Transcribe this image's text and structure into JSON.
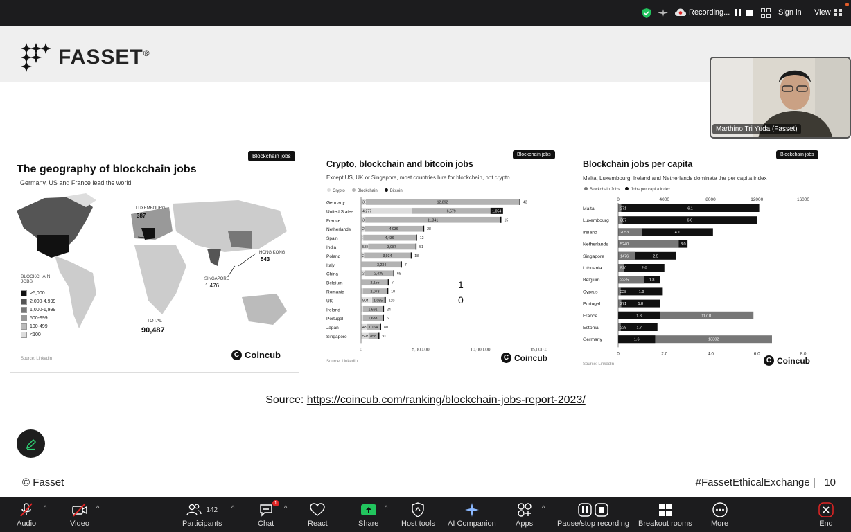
{
  "topbar": {
    "recording_label": "Recording...",
    "signin_label": "Sign in",
    "view_label": "View"
  },
  "slide": {
    "logo": "FASSET",
    "logo_mark": "®",
    "map": {
      "tag": "Blockchain jobs",
      "title": "The geography of blockchain jobs",
      "subtitle": "Germany, US and France lead the world",
      "legend_title": "BLOCKCHAIN JOBS",
      "legend": [
        {
          "label": ">5,000",
          "color": "#111111"
        },
        {
          "label": "2,000-4,999",
          "color": "#555555"
        },
        {
          "label": "1,000-1,999",
          "color": "#777777"
        },
        {
          "label": "500-999",
          "color": "#999999"
        },
        {
          "label": "100-499",
          "color": "#bbbbbb"
        },
        {
          "label": "<100",
          "color": "#dddddd"
        }
      ],
      "total_label": "TOTAL",
      "total_value": "90,487",
      "luxembourg_label": "LUXEMBOURG",
      "luxembourg_value": "387",
      "hongkong_label": "HONG KONG",
      "hongkong_value": "543",
      "singapore_label": "SINGAPORE",
      "singapore_value": "1,476",
      "source": "Source: LinkedIn",
      "brand": "Coincub"
    },
    "bar": {
      "tag": "Blockchain jobs",
      "title": "Crypto, blockchain and bitcoin jobs",
      "subtitle": "Except US, UK or Singapore, most countries hire for blockchain, not crypto",
      "legend": [
        "Crypto",
        "Blockchain",
        "Bitcoin"
      ],
      "source": "Source: LinkedIn",
      "brand": "Coincub",
      "overlay_numbers": [
        "1",
        "0"
      ]
    },
    "percap": {
      "tag": "Blockchain jobs",
      "title": "Blockchain jobs per capita",
      "subtitle": "Malta, Luxembourg, Ireland and Netherlands dominate the per capita index",
      "legend": [
        "Blockchain Jobs",
        "Jobs per capita index"
      ],
      "source": "Source: LinkedIn",
      "brand": "Coincub"
    },
    "source_prefix": "Source: ",
    "source_url": "https://coincub.com/ranking/blockchain-jobs-report-2023/",
    "footer_left": "© Fasset",
    "footer_right": "#FassetEthicalExchange |",
    "page_number": "10"
  },
  "chart_data": [
    {
      "type": "bar",
      "orientation": "horizontal",
      "stacked": true,
      "title": "Crypto, blockchain and bitcoin jobs",
      "subtitle": "Except US, UK or Singapore, most countries hire for blockchain, not crypto",
      "categories": [
        "Germany",
        "United States",
        "France",
        "Netherlands",
        "Spain",
        "India",
        "Poland",
        "Italy",
        "China",
        "Belgium",
        "Romania",
        "UK",
        "Ireland",
        "Portugal",
        "Japan",
        "Singapore"
      ],
      "series": [
        {
          "name": "Crypto",
          "values": [
            387,
            4277,
            345,
            276,
            173,
            583,
            234,
            104,
            261,
            70,
            125,
            904,
            146,
            142,
            435,
            593
          ]
        },
        {
          "name": "Blockchain",
          "values": [
            12892,
            6579,
            11341,
            4936,
            4436,
            3987,
            3934,
            3234,
            2439,
            2155,
            2073,
            1055,
            1691,
            1688,
            1164,
            858
          ]
        },
        {
          "name": "Bitcoin",
          "values": [
            43,
            1054,
            15,
            28,
            12,
            51,
            18,
            7,
            68,
            7,
            10,
            120,
            24,
            6,
            80,
            91
          ]
        }
      ],
      "xticks": [
        "0",
        "5,000.00",
        "10,000.00",
        "15,000.00"
      ],
      "xlim": [
        0,
        15000
      ],
      "colors": {
        "Crypto": "#dddddd",
        "Blockchain": "#b3b3b3",
        "Bitcoin": "#111111"
      }
    },
    {
      "type": "bar",
      "orientation": "horizontal",
      "title": "Blockchain jobs per capita",
      "subtitle": "Malta, Luxembourg, Ireland and Netherlands dominate the per capita index",
      "categories": [
        "Malta",
        "Luxembourg",
        "Ireland",
        "Netherlands",
        "Singapore",
        "Lithuania",
        "Belgium",
        "Cyprus",
        "Portugal",
        "France",
        "Estonia",
        "Germany"
      ],
      "series": [
        {
          "name": "Blockchain Jobs",
          "labels": [
            "271",
            "387",
            "2053",
            "5240",
            "1476",
            "520",
            "2235",
            "228",
            "271",
            "11701",
            "228",
            "13302"
          ],
          "values": [
            271,
            387,
            2053,
            5240,
            1476,
            520,
            2235,
            228,
            271,
            11701,
            228,
            13302
          ]
        },
        {
          "name": "Jobs per capita index",
          "labels": [
            "6.1",
            "6.0",
            "4.1",
            "3.0",
            "2.5",
            "2.0",
            "1.8",
            "1.9",
            "1.8",
            "1.8",
            "1.7",
            "1.6"
          ],
          "values": [
            6.1,
            6.0,
            4.1,
            3.0,
            2.5,
            2.0,
            1.8,
            1.9,
            1.8,
            1.8,
            1.7,
            1.6
          ]
        }
      ],
      "xticks_top": [
        "0",
        "4000",
        "8000",
        "12000",
        "16000"
      ],
      "xticks_bottom": [
        "0",
        "2.0",
        "4.0",
        "6.0",
        "8.0"
      ],
      "xlim_top": [
        0,
        16000
      ],
      "xlim_bottom": [
        0,
        8
      ],
      "colors": {
        "Blockchain Jobs": "#777777",
        "Jobs per capita index": "#111111"
      }
    }
  ],
  "video": {
    "name": "Marthino Tri Yuda (Fasset)"
  },
  "toolbar": {
    "audio": "Audio",
    "video": "Video",
    "participants": "Participants",
    "participants_count": "142",
    "chat": "Chat",
    "chat_badge": "1",
    "react": "React",
    "share": "Share",
    "host_tools": "Host tools",
    "ai_companion": "AI Companion",
    "apps": "Apps",
    "pause_recording": "Pause/stop recording",
    "breakout": "Breakout rooms",
    "more": "More",
    "end": "End"
  }
}
